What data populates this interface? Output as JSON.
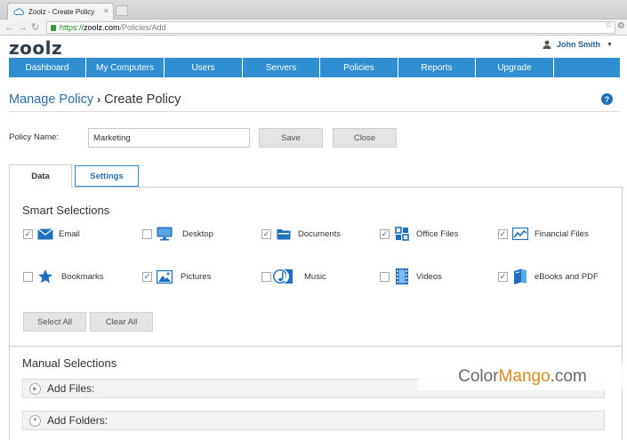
{
  "browser": {
    "tab_title": "Zoolz - Create Policy",
    "url_https": "https://",
    "url_host": "zoolz.com",
    "url_path": "/Policies/Add"
  },
  "header": {
    "logo": "zoolz",
    "user_name": "John Smith"
  },
  "nav": [
    {
      "label": "Dashboard"
    },
    {
      "label": "My Computers"
    },
    {
      "label": "Users"
    },
    {
      "label": "Servers"
    },
    {
      "label": "Policies"
    },
    {
      "label": "Reports"
    },
    {
      "label": "Upgrade"
    },
    {
      "label": ""
    }
  ],
  "breadcrumb": {
    "parent": "Manage Policy",
    "current": "Create Policy",
    "help": "?"
  },
  "form": {
    "policy_name_label": "Policy Name:",
    "policy_name_value": "Marketing",
    "save_label": "Save",
    "close_label": "Close"
  },
  "tabs": {
    "data": "Data",
    "settings": "Settings"
  },
  "smart": {
    "title": "Smart Selections",
    "items": [
      {
        "label": "Email",
        "checked": true,
        "icon": "envelope-icon"
      },
      {
        "label": "Desktop",
        "checked": false,
        "icon": "monitor-icon"
      },
      {
        "label": "Documents",
        "checked": true,
        "icon": "folder-icon"
      },
      {
        "label": "Office Files",
        "checked": true,
        "icon": "office-grid-icon"
      },
      {
        "label": "Financial Files",
        "checked": true,
        "icon": "chart-line-icon"
      },
      {
        "label": "Bookmarks",
        "checked": false,
        "icon": "star-icon"
      },
      {
        "label": "Pictures",
        "checked": true,
        "icon": "picture-icon"
      },
      {
        "label": "Music",
        "checked": false,
        "icon": "music-note-icon"
      },
      {
        "label": "Videos",
        "checked": false,
        "icon": "film-strip-icon"
      },
      {
        "label": "eBooks and PDF",
        "checked": true,
        "icon": "book-icon"
      }
    ],
    "select_all": "Select All",
    "clear_all": "Clear All"
  },
  "manual": {
    "title": "Manual Selections",
    "add_files": "Add Files:",
    "add_folders": "Add Folders:"
  },
  "watermark": {
    "part1": "Color",
    "part2": "Mango",
    "part3": ".com"
  },
  "colors": {
    "nav_bg": "#2f8fd0",
    "link": "#2a6faa",
    "icon_blue": "#1e6fc0"
  }
}
